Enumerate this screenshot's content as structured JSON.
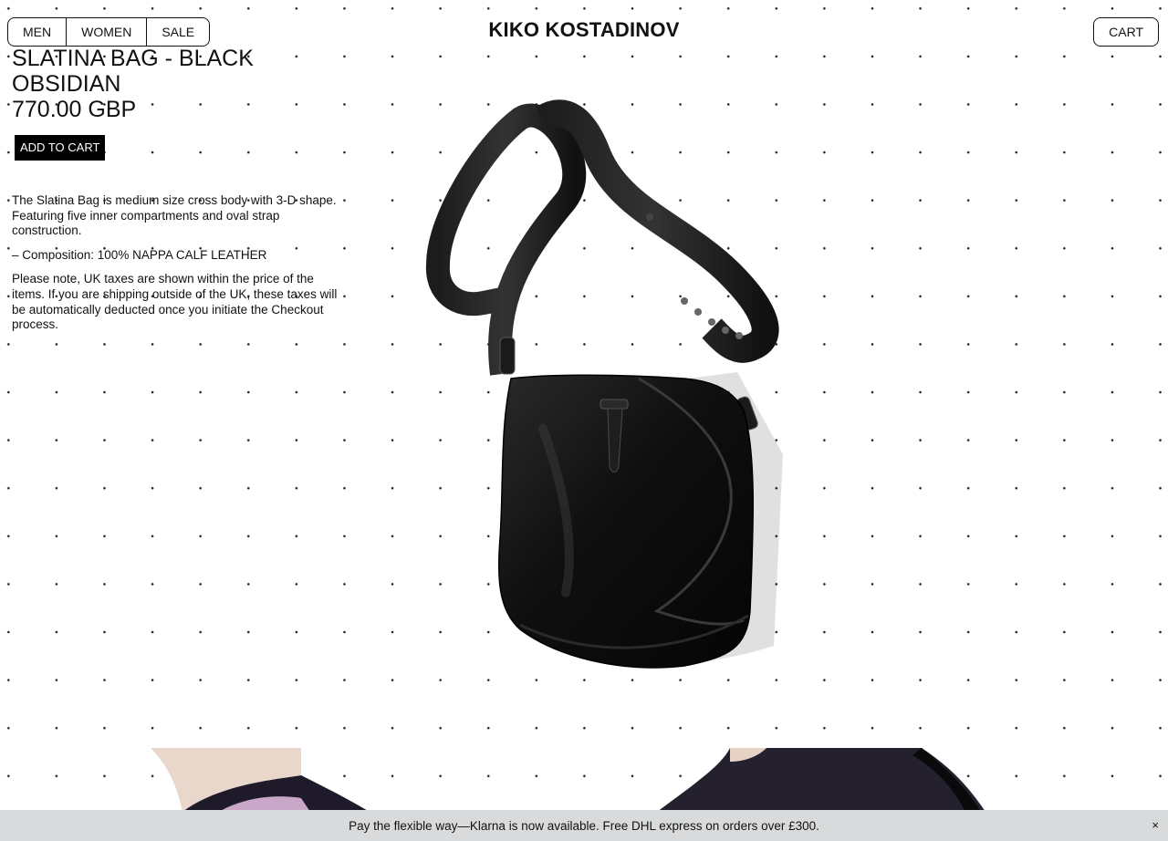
{
  "nav": {
    "men": "MEN",
    "women": "WOMEN",
    "sale": "SALE",
    "cart": "CART"
  },
  "brand": {
    "logo": "KIKO KOSTADINOV"
  },
  "product": {
    "title": "SLATINA BAG - BLACK OBSIDIAN",
    "price": "770.00 GBP",
    "add_to_cart": "ADD TO CART",
    "description": "The Slatina Bag is medium size cross body with 3-D shape. Featuring five inner compartments and oval strap construction.",
    "composition": "– Composition: 100% NAPPA CALF LEATHER",
    "tax_note": "Please note, UK taxes are shown within the price of the items. If you are shipping outside of the UK, these taxes will be automatically deducted once you initiate the Checkout process."
  },
  "banner": {
    "text": "Pay the flexible way—Klarna is now available. Free DHL express on orders over £300.",
    "close": "×"
  },
  "colors": {
    "banner_bg": "#d8dadb",
    "button_bg": "#000000",
    "text": "#111111"
  }
}
